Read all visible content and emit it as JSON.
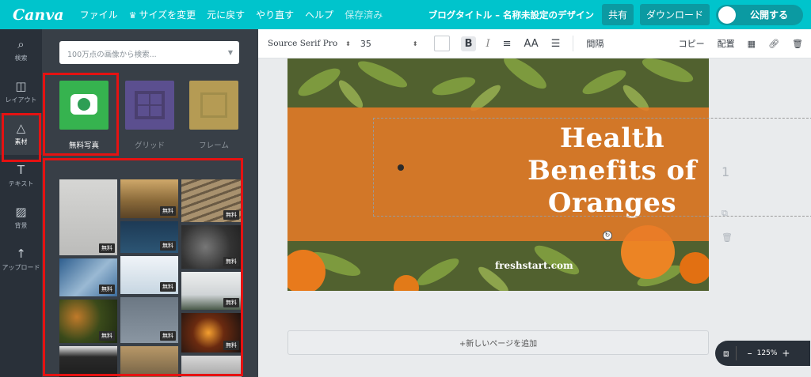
{
  "topbar": {
    "logo": "Canva",
    "file": "ファイル",
    "resize": "サイズを変更",
    "undo": "元に戻す",
    "redo": "やり直す",
    "help": "ヘルプ",
    "saved": "保存済み",
    "doc_title": "ブログタイトル – 名称未設定のデザイン",
    "share": "共有",
    "download": "ダウンロード",
    "publish": "公開する"
  },
  "sidebar": {
    "items": [
      {
        "label": "検索",
        "icon": "search-icon"
      },
      {
        "label": "レイアウト",
        "icon": "layout-icon"
      },
      {
        "label": "素材",
        "icon": "elements-icon"
      },
      {
        "label": "テキスト",
        "icon": "text-icon"
      },
      {
        "label": "背景",
        "icon": "background-icon"
      },
      {
        "label": "アップロード",
        "icon": "upload-icon"
      }
    ]
  },
  "panel": {
    "search_placeholder": "100万点の画像から検索...",
    "categories": [
      {
        "label": "無料写真",
        "color": "#36b34f"
      },
      {
        "label": "グリッド",
        "color": "#5b4f8f"
      },
      {
        "label": "フレーム",
        "color": "#b59b54"
      }
    ],
    "free_badge": "無料",
    "photos": [
      {
        "color": "#c9c9c7",
        "free": true
      },
      {
        "color": "#9c7a4a",
        "free": true
      },
      {
        "color": "#8a7762",
        "free": true
      },
      {
        "color": "#244866",
        "free": true
      },
      {
        "color": "#4a4a4a",
        "free": true
      },
      {
        "color": "#3b6a9a",
        "free": true
      },
      {
        "color": "#d9e6f0",
        "free": true
      },
      {
        "color": "#ccd0d2",
        "free": true
      },
      {
        "color": "#5a4a2a",
        "free": true
      },
      {
        "color": "#6e7a86",
        "free": true
      },
      {
        "color": "#3a2a1e",
        "free": true
      },
      {
        "color": "#2a2a2a",
        "free": false
      },
      {
        "color": "#a08a6a",
        "free": false
      },
      {
        "color": "#cfcfd0",
        "free": false
      }
    ]
  },
  "toolbar": {
    "font": "Source Serif Pro",
    "size": "35",
    "bold": "B",
    "italic": "I",
    "align_icon": "align-icon",
    "case": "AA",
    "list_icon": "list-icon",
    "spacing": "間隔",
    "copy": "コピー",
    "arrange": "配置",
    "transparency_icon": "transparency-icon",
    "link_icon": "link-icon",
    "delete_icon": "trash-icon"
  },
  "design": {
    "heading": [
      "Health",
      "Benefits of",
      "Oranges"
    ],
    "url": "freshstart.com",
    "band_color": "#e87a28",
    "page_number": "1"
  },
  "add_page": "+新しいページを追加",
  "zoom": {
    "minus": "–",
    "value": "125%",
    "plus": "+"
  }
}
